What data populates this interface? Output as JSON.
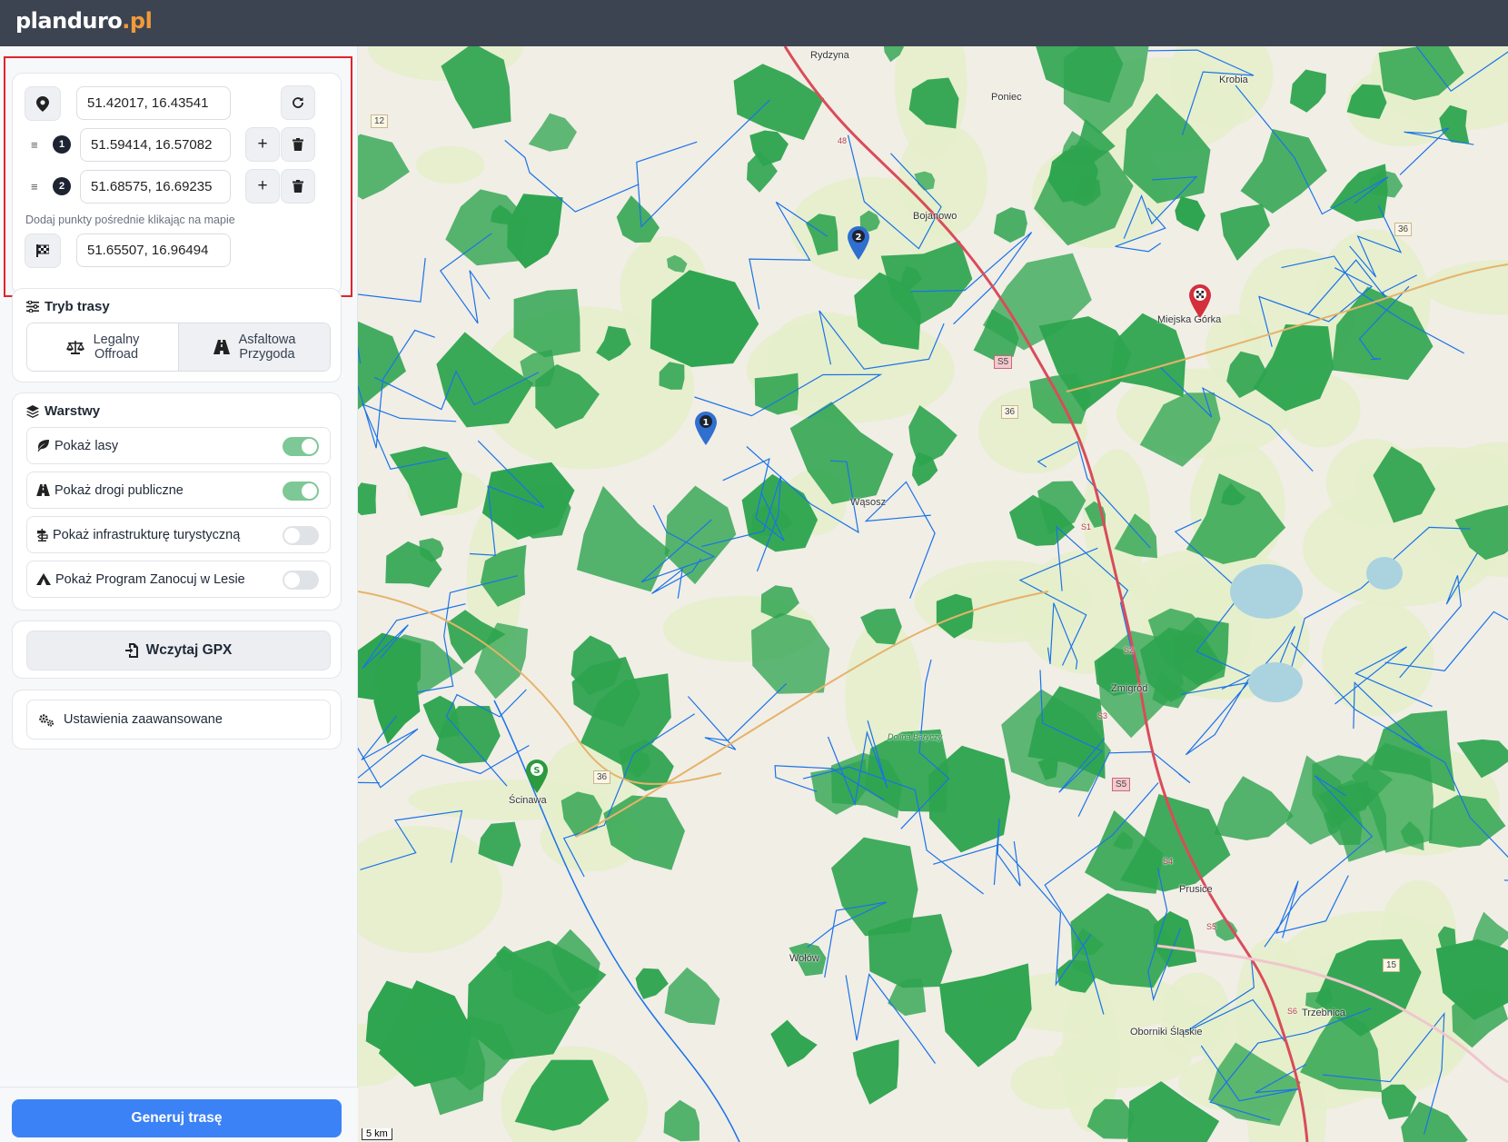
{
  "app": {
    "logo_main": "planduro",
    "logo_tld": ".pl"
  },
  "waypoints": {
    "start": {
      "value": "51.42017, 16.43541",
      "icon": "map-pin-icon"
    },
    "intermediate": [
      {
        "number": "1",
        "value": "51.59414, 16.57082"
      },
      {
        "number": "2",
        "value": "51.68575, 16.69235"
      }
    ],
    "hint": "Dodaj punkty pośrednie klikając na mapie",
    "end": {
      "value": "51.65507, 16.96494",
      "icon": "checkered-flag-icon"
    }
  },
  "route_mode": {
    "title": "Tryb trasy",
    "options": [
      {
        "label_line1": "Legalny",
        "label_line2": "Offroad",
        "icon": "scale-icon",
        "selected": true
      },
      {
        "label_line1": "Asfaltowa",
        "label_line2": "Przygoda",
        "icon": "road-icon",
        "selected": false
      }
    ]
  },
  "layers": {
    "title": "Warstwy",
    "items": [
      {
        "label": "Pokaż lasy",
        "icon": "leaf-icon",
        "on": true
      },
      {
        "label": "Pokaż drogi publiczne",
        "icon": "road-icon",
        "on": true
      },
      {
        "label": "Pokaż infrastrukturę turystyczną",
        "icon": "signpost-icon",
        "on": false
      },
      {
        "label": "Pokaż Program Zanocuj w Lesie",
        "icon": "tent-icon",
        "on": false
      }
    ]
  },
  "gpx_button": "Wczytaj GPX",
  "advanced_button": "Ustawienia zaawansowane",
  "generate_button": "Generuj trasę",
  "map": {
    "place_labels": [
      "Rydzyna",
      "Poniec",
      "Krobia",
      "Bojanowo",
      "Miejska Górka",
      "Wąsosz",
      "Zmigród",
      "Ścinawa",
      "Prusice",
      "Wołów",
      "Oborniki Śląskie",
      "Trzebnica",
      "Dolina Baryczy"
    ],
    "road_shields": [
      "12",
      "36",
      "36",
      "36",
      "S5",
      "S5",
      "15",
      "S1",
      "S2",
      "S3",
      "S4",
      "S5",
      "S6",
      "48"
    ],
    "scale_label": "5 km",
    "marker_labels": [
      "1",
      "2",
      "S"
    ],
    "colors": {
      "forest": "#2ea44f",
      "water": "#1a73e8",
      "route_red": "#d94c5a",
      "start_marker": "#2c9a3e",
      "end_marker": "#d32f3c",
      "waypoint_marker": "#2f6fd0"
    }
  }
}
